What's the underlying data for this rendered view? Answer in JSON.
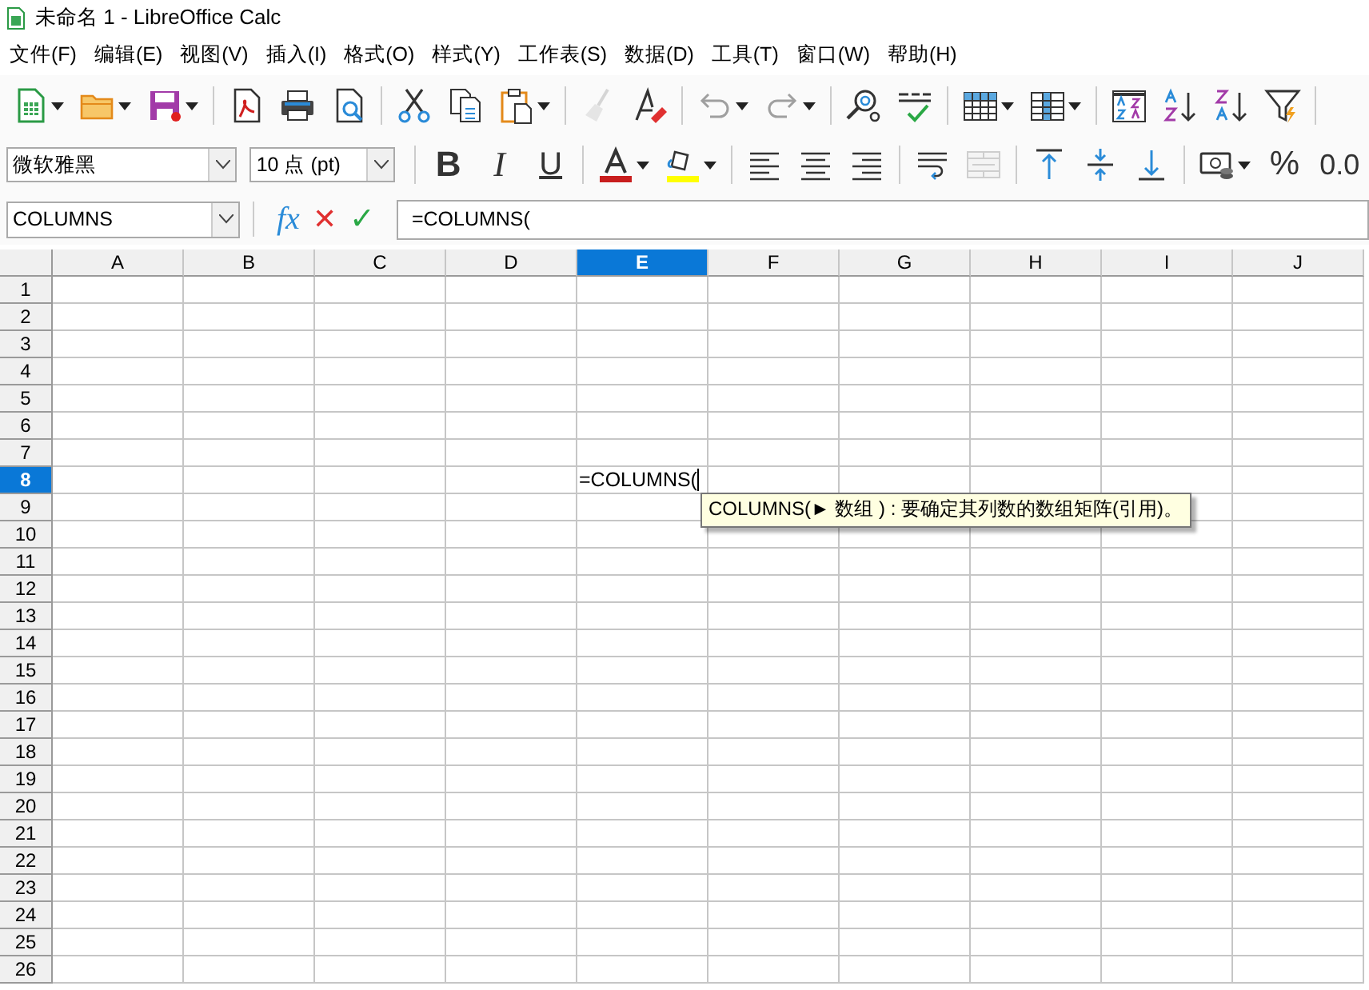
{
  "window": {
    "title": "未命名 1 - LibreOffice Calc"
  },
  "menu": [
    "文件(F)",
    "编辑(E)",
    "视图(V)",
    "插入(I)",
    "格式(O)",
    "样式(Y)",
    "工作表(S)",
    "数据(D)",
    "工具(T)",
    "窗口(W)",
    "帮助(H)"
  ],
  "standard_toolbar": [
    [
      {
        "kind": "new",
        "disabled": false
      },
      {
        "kind": "open",
        "disabled": false
      },
      {
        "kind": "save",
        "disabled": false
      }
    ],
    [
      {
        "kind": "pdf",
        "disabled": false
      },
      {
        "kind": "print",
        "disabled": false
      },
      {
        "kind": "preview",
        "disabled": false
      }
    ],
    [
      {
        "kind": "cut",
        "disabled": false
      },
      {
        "kind": "copy",
        "disabled": false
      },
      {
        "kind": "paste",
        "disabled": false
      }
    ],
    [
      {
        "kind": "clear",
        "disabled": true
      },
      {
        "kind": "clone",
        "disabled": false
      }
    ],
    [
      {
        "kind": "undo",
        "disabled": true
      },
      {
        "kind": "redo",
        "disabled": true
      }
    ],
    [
      {
        "kind": "find",
        "disabled": false
      },
      {
        "kind": "spell",
        "disabled": false
      }
    ],
    [
      {
        "kind": "rows",
        "disabled": false
      },
      {
        "kind": "cols",
        "disabled": false
      }
    ],
    [
      {
        "kind": "sortdlg",
        "disabled": false
      },
      {
        "kind": "sortasc",
        "disabled": false
      },
      {
        "kind": "sortdesc",
        "disabled": false
      },
      {
        "kind": "filter",
        "disabled": false
      }
    ]
  ],
  "format_toolbar": [
    [
      {
        "kind": "font_name",
        "value": "微软雅黑",
        "disabled": false
      },
      {
        "kind": "font_size",
        "value": "10 点 (pt)",
        "disabled": false
      }
    ],
    [
      {
        "kind": "bold",
        "label": "B",
        "disabled": false
      },
      {
        "kind": "italic",
        "label": "I",
        "disabled": false
      },
      {
        "kind": "underline",
        "label": "U",
        "disabled": false
      }
    ],
    [
      {
        "kind": "fontcolor",
        "disabled": false
      },
      {
        "kind": "highlight",
        "disabled": false
      }
    ],
    [
      {
        "kind": "alignleft",
        "disabled": false
      },
      {
        "kind": "aligncenter",
        "disabled": false
      },
      {
        "kind": "alignright",
        "disabled": false
      }
    ],
    [
      {
        "kind": "wrap",
        "disabled": false
      },
      {
        "kind": "merge",
        "disabled": true
      }
    ],
    [
      {
        "kind": "aligntop",
        "disabled": false
      },
      {
        "kind": "alignmiddle",
        "disabled": false
      },
      {
        "kind": "alignbottom",
        "disabled": false
      }
    ],
    [
      {
        "kind": "currency",
        "disabled": false
      },
      {
        "kind": "percent",
        "label": "%",
        "disabled": false
      },
      {
        "kind": "decimal",
        "label": "0.0",
        "disabled": false
      }
    ]
  ],
  "formula_bar": {
    "name_box": "COLUMNS",
    "function_wizard": "fx",
    "cancel": "✕",
    "accept": "✓",
    "formula": "=COLUMNS("
  },
  "sheet": {
    "columns": [
      {
        "label": "A",
        "selected": false
      },
      {
        "label": "B",
        "selected": false
      },
      {
        "label": "C",
        "selected": false
      },
      {
        "label": "D",
        "selected": false
      },
      {
        "label": "E",
        "selected": true
      },
      {
        "label": "F",
        "selected": false
      },
      {
        "label": "G",
        "selected": false
      },
      {
        "label": "H",
        "selected": false
      },
      {
        "label": "I",
        "selected": false
      },
      {
        "label": "J",
        "selected": false
      }
    ],
    "rows": [
      {
        "label": "1",
        "selected": false
      },
      {
        "label": "2",
        "selected": false
      },
      {
        "label": "3",
        "selected": false
      },
      {
        "label": "4",
        "selected": false
      },
      {
        "label": "5",
        "selected": false
      },
      {
        "label": "6",
        "selected": false
      },
      {
        "label": "7",
        "selected": false
      },
      {
        "label": "8",
        "selected": true
      },
      {
        "label": "9",
        "selected": false
      },
      {
        "label": "10",
        "selected": false
      },
      {
        "label": "11",
        "selected": false
      },
      {
        "label": "12",
        "selected": false
      },
      {
        "label": "13",
        "selected": false
      },
      {
        "label": "14",
        "selected": false
      },
      {
        "label": "15",
        "selected": false
      },
      {
        "label": "16",
        "selected": false
      },
      {
        "label": "17",
        "selected": false
      },
      {
        "label": "18",
        "selected": false
      },
      {
        "label": "19",
        "selected": false
      },
      {
        "label": "20",
        "selected": false
      },
      {
        "label": "21",
        "selected": false
      },
      {
        "label": "22",
        "selected": false
      },
      {
        "label": "23",
        "selected": false
      },
      {
        "label": "24",
        "selected": false
      },
      {
        "label": "25",
        "selected": false
      },
      {
        "label": "26",
        "selected": false
      }
    ],
    "active_cell_text": "=COLUMNS(",
    "tooltip": "COLUMNS(► 数组 ) : 要确定其列数的数组矩阵(引用)。"
  }
}
